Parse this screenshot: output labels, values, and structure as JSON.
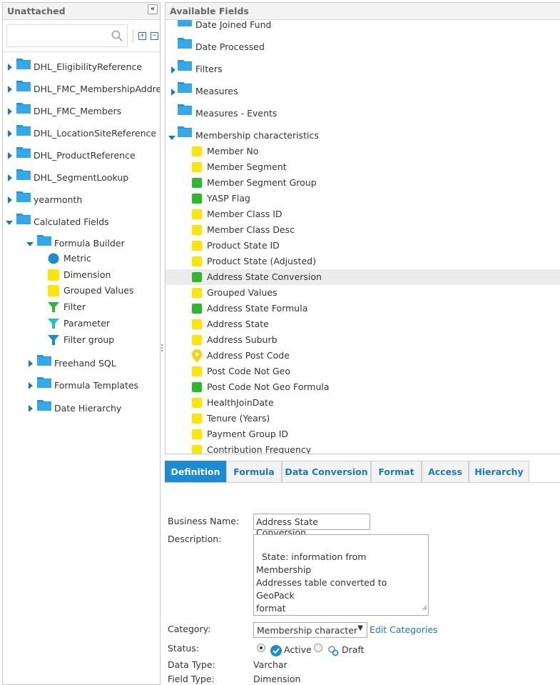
{
  "left_panel": {
    "title": "Unattached",
    "search": {
      "placeholder": "",
      "value": ""
    },
    "tables": [
      {
        "label": "DHL_EligibilityReference"
      },
      {
        "label": "DHL_FMC_MembershipAddresses"
      },
      {
        "label": "DHL_FMC_Members"
      },
      {
        "label": "DHL_LocationSiteReference"
      },
      {
        "label": "DHL_ProductReference"
      },
      {
        "label": "DHL_SegmentLookup"
      },
      {
        "label": "yearmonth"
      }
    ],
    "calculated": {
      "label": "Calculated Fields",
      "formula_builder": {
        "label": "Formula Builder",
        "items": [
          {
            "label": "Metric",
            "icon": "metric-circle-icon"
          },
          {
            "label": "Dimension",
            "icon": "dimension-square-icon"
          },
          {
            "label": "Grouped Values",
            "icon": "grouped-values-square-icon"
          },
          {
            "label": "Filter",
            "icon": "filter-funnel-icon"
          },
          {
            "label": "Parameter",
            "icon": "parameter-funnel-icon"
          },
          {
            "label": "Filter group",
            "icon": "filter-group-funnel-icon"
          }
        ]
      },
      "subfolders": [
        {
          "label": "Freehand SQL"
        },
        {
          "label": "Formula Templates"
        },
        {
          "label": "Date Hierarchy"
        }
      ]
    }
  },
  "right_panel": {
    "title": "Available Fields",
    "folders": [
      {
        "label": "Date Joined Fund"
      },
      {
        "label": "Date Processed"
      },
      {
        "label": "Filters"
      },
      {
        "label": "Measures"
      },
      {
        "label": "Measures - Events"
      },
      {
        "label": "Membership characteristics"
      }
    ],
    "fields": [
      {
        "label": "Member No",
        "color": "yellow"
      },
      {
        "label": "Member Segment",
        "color": "yellow"
      },
      {
        "label": "Member Segment Group",
        "color": "green"
      },
      {
        "label": "YASP Flag",
        "color": "green"
      },
      {
        "label": "Member Class ID",
        "color": "yellow"
      },
      {
        "label": "Member Class Desc",
        "color": "yellow"
      },
      {
        "label": "Product State ID",
        "color": "yellow"
      },
      {
        "label": "Product State (Adjusted)",
        "color": "yellow"
      },
      {
        "label": "Address State Conversion",
        "color": "green",
        "selected": true
      },
      {
        "label": "Grouped Values",
        "color": "yellow"
      },
      {
        "label": "Address State Formula",
        "color": "green"
      },
      {
        "label": "Address State",
        "color": "yellow"
      },
      {
        "label": "Address Suburb",
        "color": "yellow"
      },
      {
        "label": "Address Post Code",
        "color": "geo"
      },
      {
        "label": "Post Code Not Geo",
        "color": "yellow"
      },
      {
        "label": "Post Code Not Geo Formula",
        "color": "green"
      },
      {
        "label": "HealthJoinDate",
        "color": "yellow"
      },
      {
        "label": "Tenure (Years)",
        "color": "yellow"
      },
      {
        "label": "Payment Group ID",
        "color": "yellow"
      },
      {
        "label": "Contribution Frequency",
        "color": "yellow"
      }
    ]
  },
  "tabs": [
    {
      "label": "Definition",
      "active": true
    },
    {
      "label": "Formula"
    },
    {
      "label": "Data Conversion"
    },
    {
      "label": "Format"
    },
    {
      "label": "Access"
    },
    {
      "label": "Hierarchy"
    }
  ],
  "form": {
    "business_name_label": "Business Name:",
    "business_name_value": "Address State Conversion",
    "description_label": "Description:",
    "description_value": "State: information from  Membership\nAddresses table converted to GeoPack\nformat",
    "category_label": "Category:",
    "category_value": "Membership character",
    "edit_categories_label": "Edit Categories",
    "status_label": "Status:",
    "status_active_label": "Active",
    "status_draft_label": "Draft",
    "data_type_label": "Data Type:",
    "data_type_value": "Varchar",
    "field_type_label": "Field Type:",
    "field_type_value": "Dimension"
  },
  "colors": {
    "accent": "#1b8bd3",
    "folder": "#1a9be0",
    "yellow": "#ffe600",
    "green": "#2bba2b"
  }
}
